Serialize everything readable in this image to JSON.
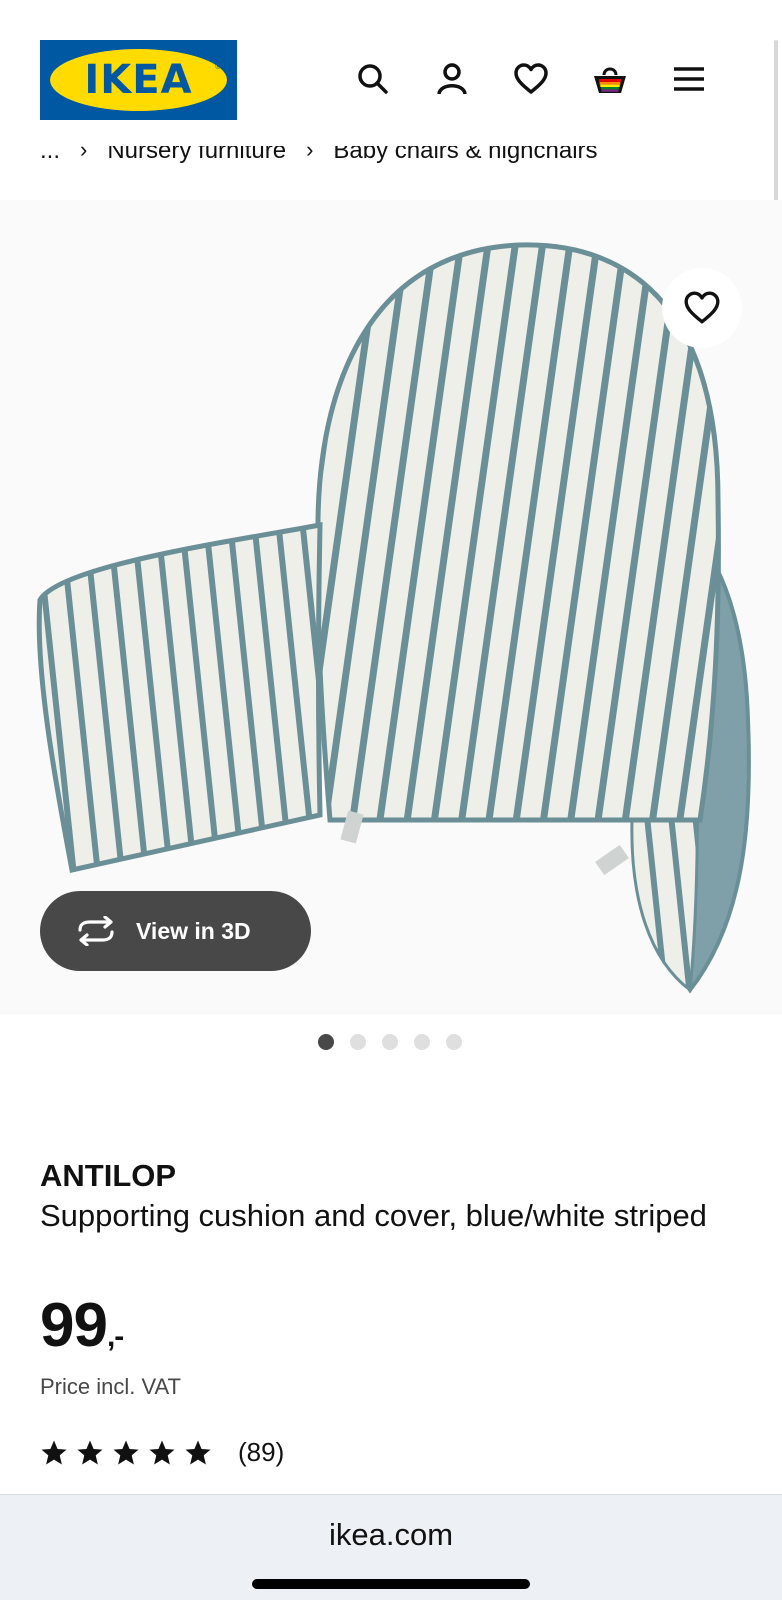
{
  "header": {
    "logo_text": "IKEA",
    "icons": [
      "search-icon",
      "account-icon",
      "favourites-icon",
      "shopping-bag-icon",
      "menu-icon"
    ]
  },
  "breadcrumb": {
    "items": [
      "...",
      "Nursery furniture",
      "Baby chairs & highchairs"
    ]
  },
  "gallery": {
    "view3d_label": "View in 3D",
    "dots_total": 5,
    "active_dot": 1
  },
  "product": {
    "name": "ANTILOP",
    "description": "Supporting cushion and cover, blue/white striped",
    "price_main": "99",
    "price_suffix": ",-",
    "price_note": "Price incl. VAT",
    "rating_stars": 5,
    "review_count": "(89)"
  },
  "browser": {
    "url": "ikea.com"
  },
  "colors": {
    "ikea_blue": "#0058a3",
    "ikea_yellow": "#ffdb00",
    "stripe": "#6b8f97",
    "cushion_side": "#7fa0a8"
  }
}
